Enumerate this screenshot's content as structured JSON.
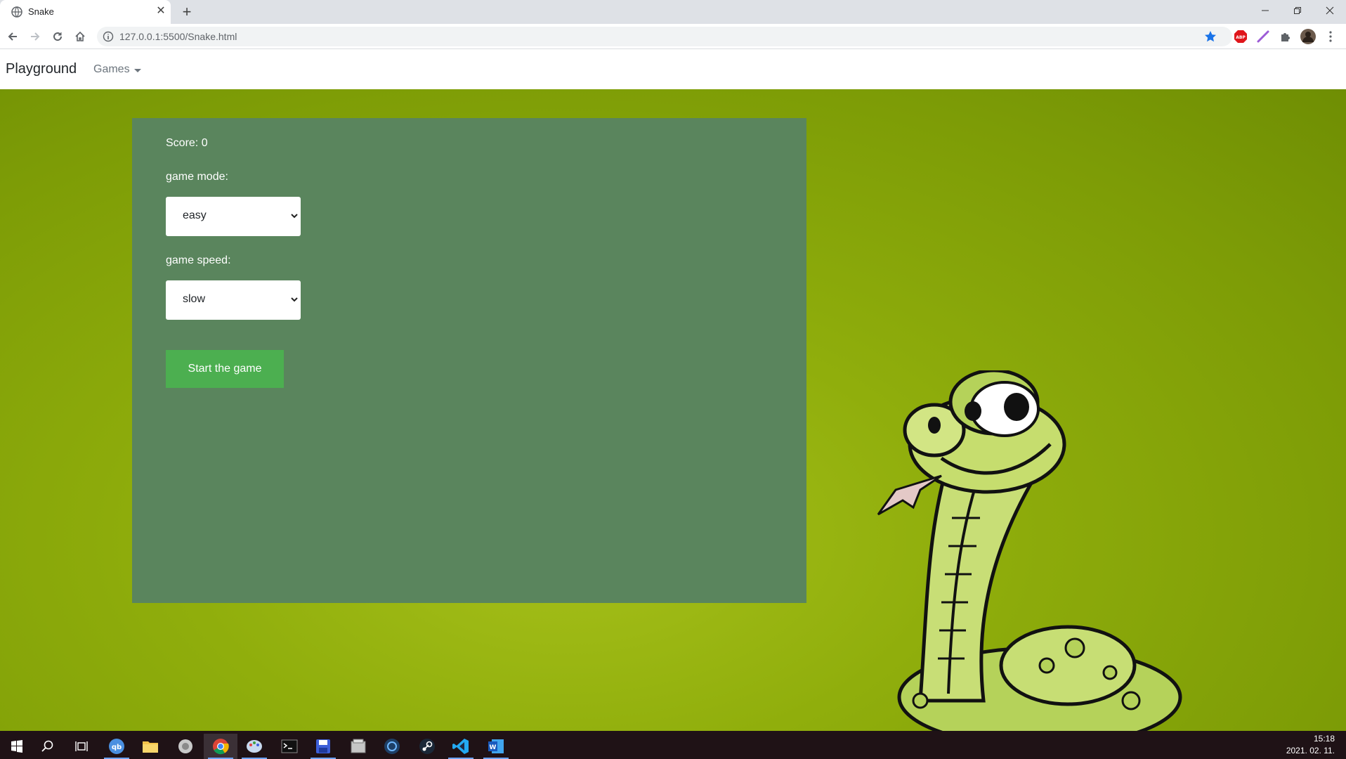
{
  "browser": {
    "tab_title": "Snake",
    "url": "127.0.0.1:5500/Snake.html"
  },
  "navbar": {
    "brand": "Playground",
    "games_label": "Games"
  },
  "game": {
    "score_text": "Score: 0",
    "mode_label": "game mode:",
    "mode_value": "easy",
    "speed_label": "game speed:",
    "speed_value": "slow",
    "start_label": "Start the game"
  },
  "taskbar": {
    "time": "15:18",
    "date": "2021. 02. 11."
  },
  "colors": {
    "panel": "#5a855d",
    "button": "#4caf50",
    "background": "#8aa80a"
  }
}
